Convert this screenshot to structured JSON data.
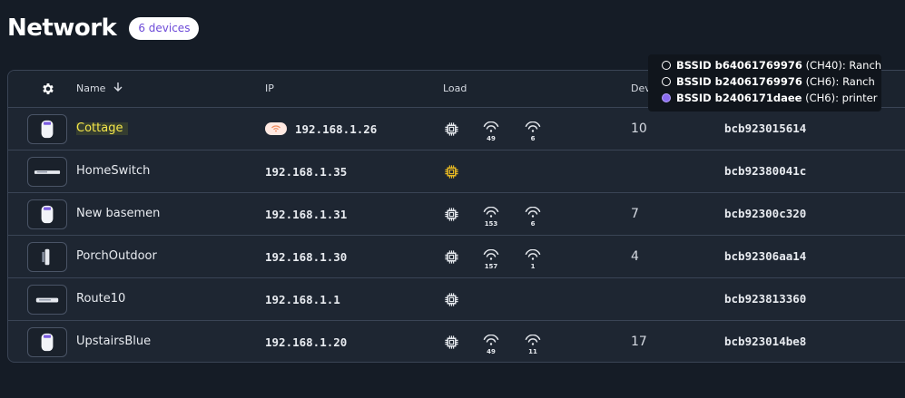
{
  "header": {
    "title": "Network",
    "count_badge": "6 devices"
  },
  "columns": {
    "name": "Name",
    "ip": "IP",
    "load": "Load",
    "devices": "Dev"
  },
  "icons": {
    "settings": "gear-icon",
    "sort": "arrow-down-icon",
    "cpu": "cpu-chip-icon",
    "wifi": "wifi-signal-icon"
  },
  "colors": {
    "accent": "#6d4bd8",
    "highlight": "#f4e64a",
    "cpu_warning": "#e8b923"
  },
  "bssid_popup": {
    "items": [
      {
        "id": "BSSID b64061769976",
        "channel": "(CH40):",
        "label": "Ranch",
        "selected": false
      },
      {
        "id": "BSSID b24061769976",
        "channel": "(CH6):",
        "label": "Ranch",
        "selected": false
      },
      {
        "id": "BSSID b2406171daee",
        "channel": "(CH6):",
        "label": "printer",
        "selected": true
      }
    ]
  },
  "devices": [
    {
      "name": "Cottage",
      "thumb": "pro-ap",
      "ip": "192.168.1.26",
      "wifi_badge": true,
      "cpu_warn": false,
      "wifi": [
        "49",
        "6"
      ],
      "devices": "10",
      "mac": "bcb923015614",
      "highlight": true
    },
    {
      "name": "HomeSwitch",
      "thumb": "switch",
      "ip": "192.168.1.35",
      "wifi_badge": false,
      "cpu_warn": true,
      "wifi": [],
      "devices": "",
      "mac": "bcb92380041c",
      "highlight": false
    },
    {
      "name": "New basemen",
      "thumb": "pro-ap",
      "ip": "192.168.1.31",
      "wifi_badge": false,
      "cpu_warn": false,
      "wifi": [
        "153",
        "6"
      ],
      "devices": "7",
      "mac": "bcb92300c320",
      "highlight": false
    },
    {
      "name": "PorchOutdoor",
      "thumb": "outdoor",
      "ip": "192.168.1.30",
      "wifi_badge": false,
      "cpu_warn": false,
      "wifi": [
        "157",
        "1"
      ],
      "devices": "4",
      "mac": "bcb92306aa14",
      "highlight": false
    },
    {
      "name": "Route10",
      "thumb": "router",
      "ip": "192.168.1.1",
      "wifi_badge": false,
      "cpu_warn": false,
      "wifi": [],
      "devices": "",
      "mac": "bcb923813360",
      "highlight": false
    },
    {
      "name": "UpstairsBlue",
      "thumb": "pro-ap",
      "ip": "192.168.1.20",
      "wifi_badge": false,
      "cpu_warn": false,
      "wifi": [
        "49",
        "11"
      ],
      "devices": "17",
      "mac": "bcb923014be8",
      "highlight": false
    }
  ]
}
